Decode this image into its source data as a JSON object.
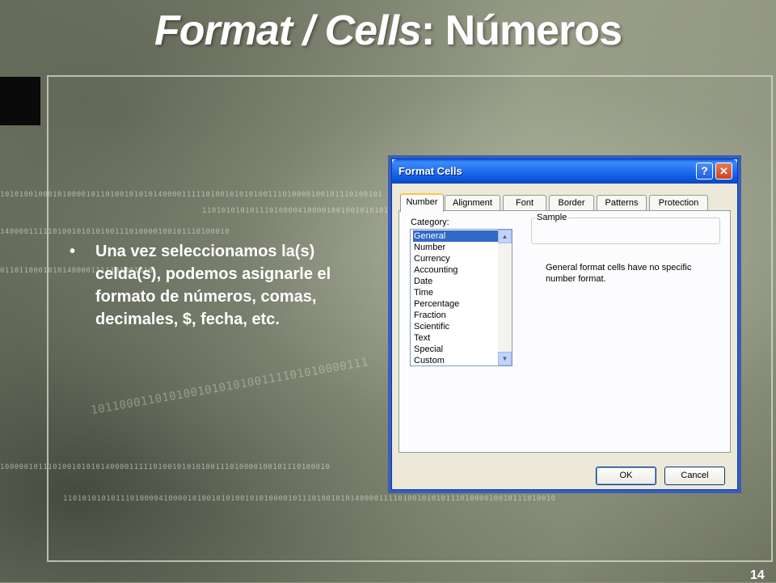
{
  "slide": {
    "title_italic": "Format / Cells",
    "title_suffix": ": Números",
    "bullet_text": "Una vez seleccionamos la(s) celda(s), podemos asignarle el formato de números, comas, decimales, $, fecha, etc.",
    "bullet_symbol": "•",
    "page_number": "14"
  },
  "background_binary": [
    "10101001000101000010110100101010140000111110100101010100111010000100101110100101",
    "11010101010111010000410000100100101010100010",
    "140000111110100101010100111010000100101110100010",
    "01101100010101400001111101001010",
    "101100011010100101010100111101010000111",
    "100000101110100101010140000111110100101010100111010000100101110100010",
    "1101010101011101000041000010100101010010101000010111010010101400001111010010101011101000010010111010010"
  ],
  "dialog": {
    "title": "Format Cells",
    "help_glyph": "?",
    "close_glyph": "✕",
    "tabs": [
      "Number",
      "Alignment",
      "Font",
      "Border",
      "Patterns",
      "Protection"
    ],
    "active_tab": "Number",
    "category_label": "Category:",
    "categories": [
      "General",
      "Number",
      "Currency",
      "Accounting",
      "Date",
      "Time",
      "Percentage",
      "Fraction",
      "Scientific",
      "Text",
      "Special",
      "Custom"
    ],
    "selected_category": "General",
    "sample_label": "Sample",
    "sample_value": "",
    "description": "General format cells have no specific number format.",
    "ok_label": "OK",
    "cancel_label": "Cancel"
  },
  "colors": {
    "titlebar": "#0a5ee8",
    "selection": "#316ac5",
    "dialog_face": "#ece9d8"
  }
}
